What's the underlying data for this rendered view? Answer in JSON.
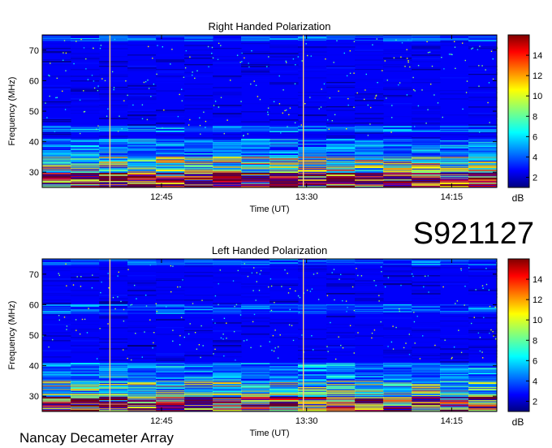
{
  "observation_id": "S921127",
  "instrument": "Nancay Decameter Array",
  "colors": {
    "frame": "#000000",
    "background": "#ffffff",
    "colormap": [
      "#00007f",
      "#0000ff",
      "#007fff",
      "#00ffff",
      "#7fff7f",
      "#ffff00",
      "#ff7f00",
      "#ff0000",
      "#7f0000"
    ]
  },
  "chart_data": [
    {
      "type": "heatmap",
      "title": "Right Handed Polarization",
      "xlabel": "Time (UT)",
      "ylabel": "Frequency (MHz)",
      "x_ticks": [
        "12:45",
        "13:30",
        "14:15"
      ],
      "x_tick_minutes": [
        765,
        810,
        855
      ],
      "xlim_minutes": [
        728,
        869
      ],
      "y_ticks": [
        30,
        40,
        50,
        60,
        70
      ],
      "ylim": [
        25,
        75
      ],
      "colorbar": {
        "label": "dB",
        "ticks": [
          2,
          4,
          6,
          8,
          10,
          12,
          14
        ],
        "range": [
          1,
          16
        ],
        "colormap": "jet"
      },
      "vertical_lines_minutes": [
        749,
        809
      ],
      "emission_bands_mhz": [
        {
          "f0": 25,
          "f1": 30,
          "level": 15
        },
        {
          "f0": 30,
          "f1": 35,
          "level": 9
        },
        {
          "f0": 35,
          "f1": 41,
          "level": 5
        },
        {
          "f0": 43,
          "f1": 45,
          "level": 5
        },
        {
          "f0": 73,
          "f1": 75,
          "level": 4
        }
      ]
    },
    {
      "type": "heatmap",
      "title": "Left Handed Polarization",
      "xlabel": "Time (UT)",
      "ylabel": "Frequency (MHz)",
      "x_ticks": [
        "12:45",
        "13:30",
        "14:15"
      ],
      "x_tick_minutes": [
        765,
        810,
        855
      ],
      "xlim_minutes": [
        728,
        869
      ],
      "y_ticks": [
        30,
        40,
        50,
        60,
        70
      ],
      "ylim": [
        25,
        75
      ],
      "colorbar": {
        "label": "dB",
        "ticks": [
          2,
          4,
          6,
          8,
          10,
          12,
          14
        ],
        "range": [
          1,
          16
        ],
        "colormap": "jet"
      },
      "vertical_lines_minutes": [
        749,
        809
      ],
      "emission_bands_mhz": [
        {
          "f0": 25,
          "f1": 30,
          "level": 14
        },
        {
          "f0": 30,
          "f1": 35,
          "level": 8
        },
        {
          "f0": 35,
          "f1": 41,
          "level": 5
        },
        {
          "f0": 57,
          "f1": 60,
          "level": 4
        },
        {
          "f0": 73,
          "f1": 75,
          "level": 4
        }
      ]
    }
  ]
}
